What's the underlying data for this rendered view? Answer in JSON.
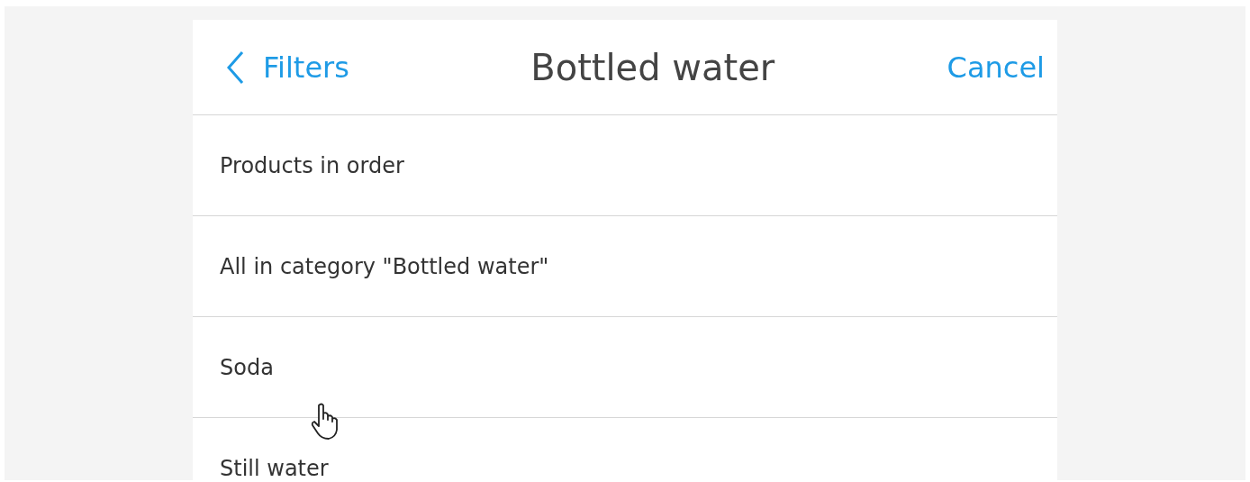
{
  "header": {
    "back_label": "Filters",
    "title": "Bottled water",
    "cancel_label": "Cancel"
  },
  "options": [
    {
      "label": "Products in order"
    },
    {
      "label": "All in category \"Bottled water\""
    },
    {
      "label": "Soda"
    },
    {
      "label": "Still water"
    }
  ]
}
